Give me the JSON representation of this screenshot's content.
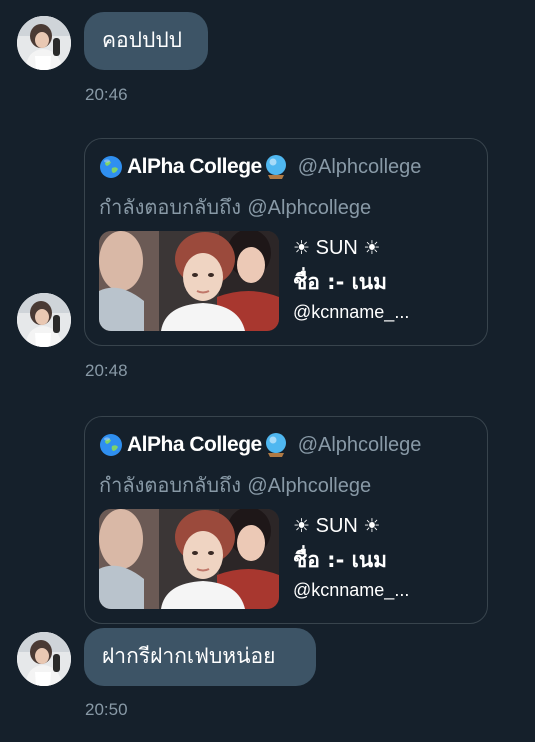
{
  "messages": [
    {
      "text": "คอปปปป",
      "time": "20:46"
    },
    {
      "time": "20:48",
      "card": {
        "account_name": "AlPha College",
        "handle": "@Alphcollege",
        "reply_prefix": "กำลังตอบกลับถึง",
        "reply_handle": "@Alphcollege",
        "preview_title_sun_left": "☀",
        "preview_title": "SUN",
        "preview_title_sun_right": "☀",
        "preview_name": "ชื่อ :- เนม",
        "preview_link": "@kcnname_..."
      }
    },
    {
      "time": "",
      "card": {
        "account_name": "AlPha College",
        "handle": "@Alphcollege",
        "reply_prefix": "กำลังตอบกลับถึง",
        "reply_handle": "@Alphcollege",
        "preview_title_sun_left": "☀",
        "preview_title": "SUN",
        "preview_title_sun_right": "☀",
        "preview_name": "ชื่อ :- เนม",
        "preview_link": "@kcnname_..."
      }
    },
    {
      "text": "ฝากรีฝากเฟบหน่อย",
      "time": "20:50"
    }
  ],
  "icons": {
    "account_globe": "globe-icon",
    "account_badge": "crystal-ball-icon"
  },
  "colors": {
    "background": "#15202b",
    "bubble": "#3d5466",
    "secondary_text": "#8899a6",
    "card_border": "#38444d"
  }
}
